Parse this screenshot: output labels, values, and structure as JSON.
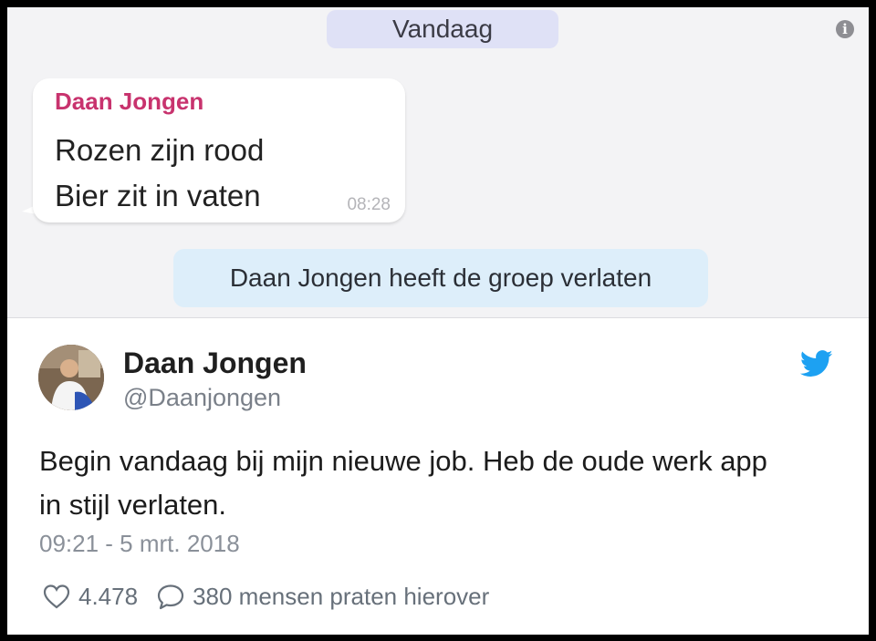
{
  "chat": {
    "date_label": "Vandaag",
    "message": {
      "sender": "Daan Jongen",
      "lines": [
        "Rozen zijn rood",
        "Bier zit in vaten"
      ],
      "time": "08:28"
    },
    "system_notice": "Daan Jongen heeft de groep verlaten",
    "info_icon": "info-icon"
  },
  "tweet": {
    "author_name": "Daan Jongen",
    "author_handle": "@Daanjongen",
    "text_line1": "Begin vandaag bij mijn nieuwe job. Heb de oude werk app",
    "text_line2": "in stijl verlaten.",
    "timestamp": "09:21 - 5 mrt. 2018",
    "likes": "4.478",
    "replies_label": "380 mensen praten hierover",
    "icons": {
      "brand": "twitter-bird-icon",
      "like": "heart-icon",
      "reply": "speech-bubble-icon"
    }
  },
  "colors": {
    "sender": "#c8336e",
    "date_pill": "#dfe1f6",
    "system_pill": "#ddeefa",
    "twitter_blue": "#1da1f2"
  }
}
